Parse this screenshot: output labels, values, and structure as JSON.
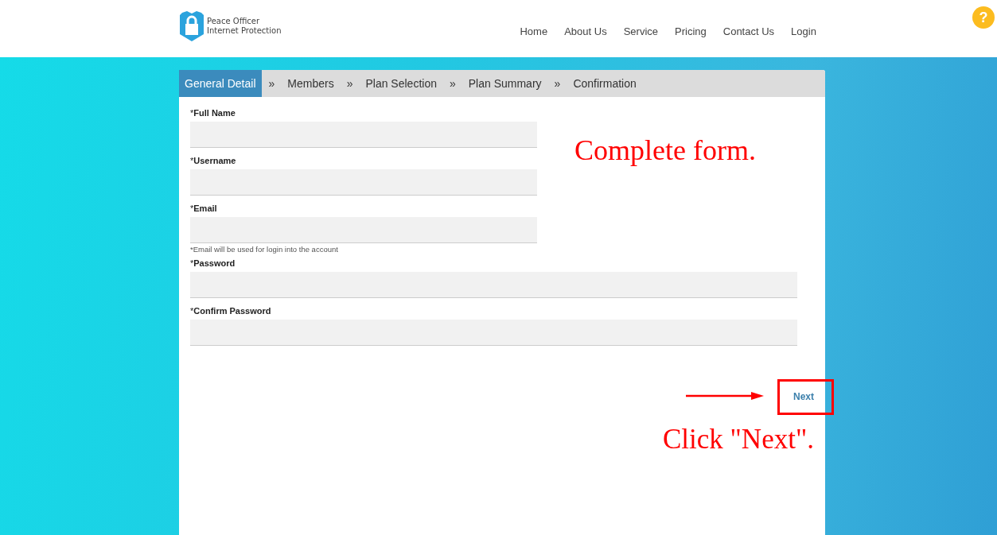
{
  "logo": {
    "line_1": "Peace Officer",
    "line_2": "Internet Protection"
  },
  "nav": [
    {
      "label": "Home"
    },
    {
      "label": "About Us"
    },
    {
      "label": "Service"
    },
    {
      "label": "Pricing"
    },
    {
      "label": "Contact Us"
    },
    {
      "label": "Login"
    }
  ],
  "help": {
    "symbol": "?"
  },
  "steps": [
    {
      "label": "General Detail",
      "selected": true
    },
    {
      "label": "Members",
      "selected": false
    },
    {
      "label": "Plan Selection",
      "selected": false
    },
    {
      "label": "Plan Summary",
      "selected": false
    },
    {
      "label": "Confirmation",
      "selected": false
    }
  ],
  "step_separator": "»",
  "fields": [
    {
      "required": "*",
      "label": "Full Name",
      "kind": "short"
    },
    {
      "required": "*",
      "label": "Username",
      "kind": "short"
    },
    {
      "required": "*",
      "label": "Email",
      "kind": "short",
      "note": "*Email will be used for login into the account"
    },
    {
      "required": "*",
      "label": "Password",
      "kind": "wide"
    },
    {
      "required": "*",
      "label": "Confirm Password",
      "kind": "wide"
    }
  ],
  "next_button": "Next",
  "annotations": {
    "top": "Complete form.",
    "bottom": "Click \"Next\"."
  }
}
